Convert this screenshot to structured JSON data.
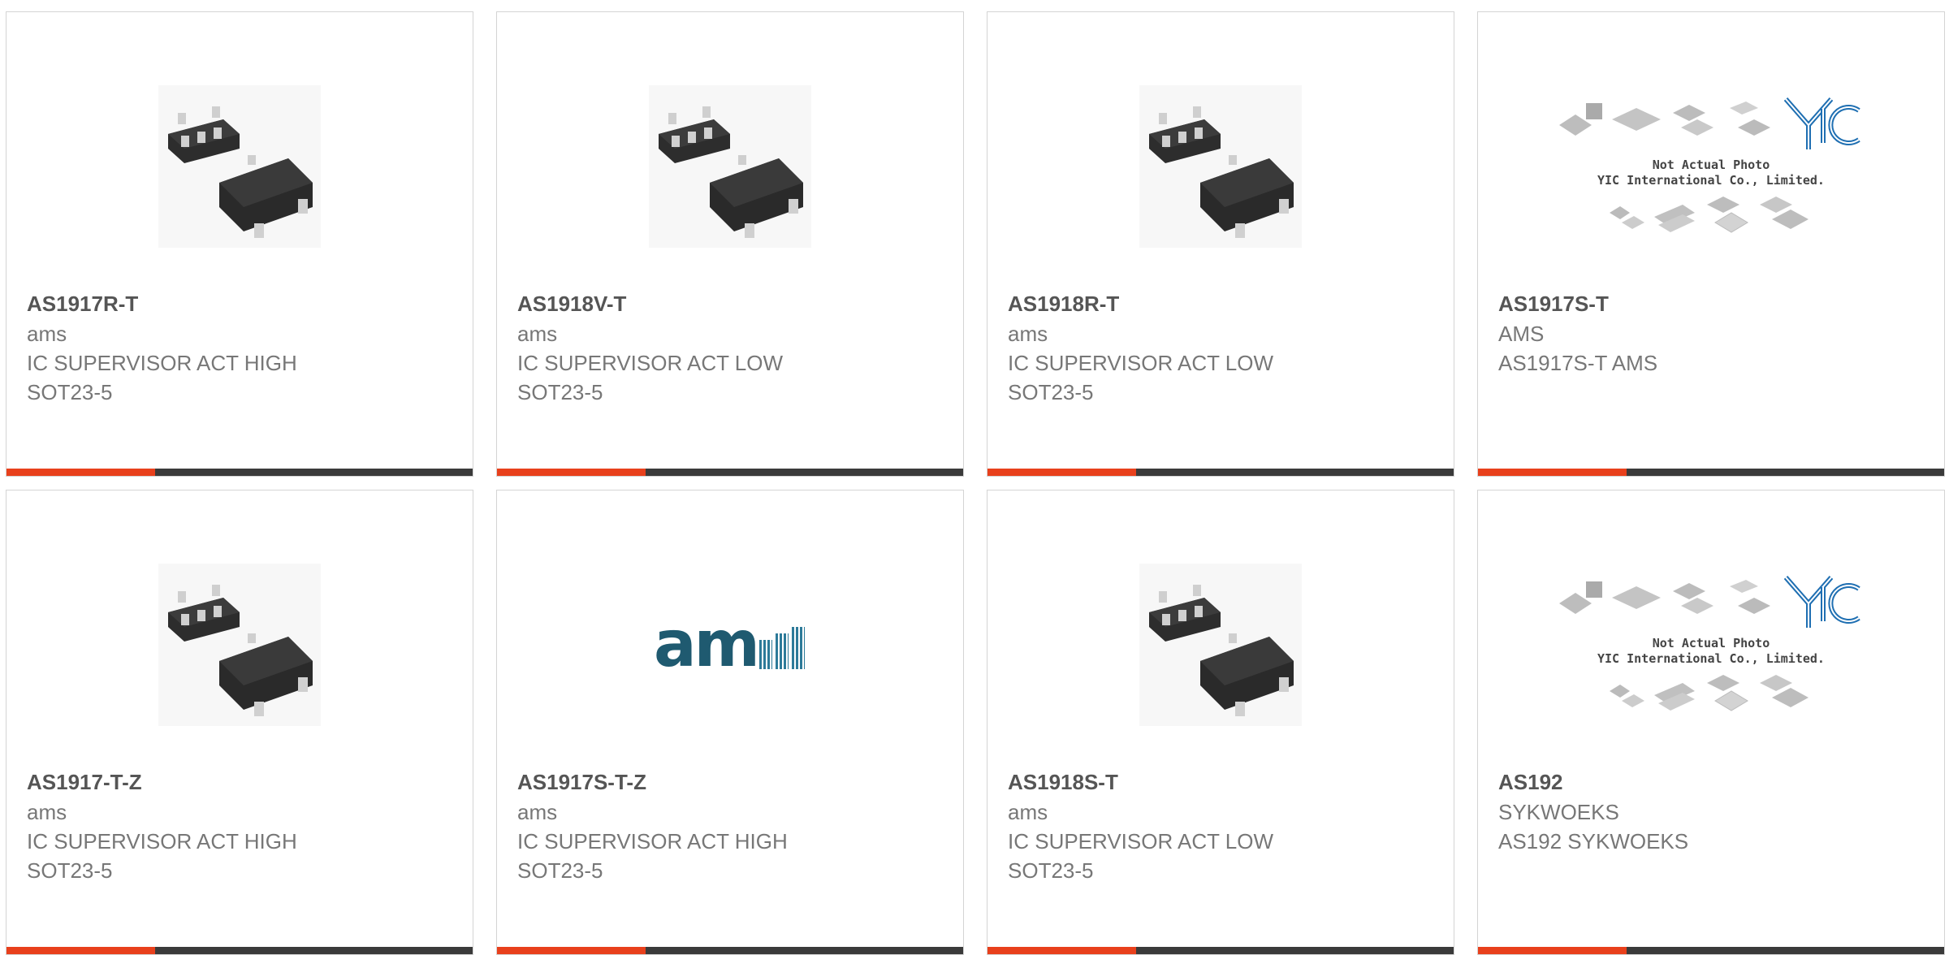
{
  "accent_color": "#e8401c",
  "bar_color": "#3a3a3a",
  "products": [
    {
      "part": "AS1917R-T",
      "lines": [
        "ams",
        "IC SUPERVISOR ACT HIGH",
        "SOT23-5"
      ],
      "image": "sot23-5-package"
    },
    {
      "part": "AS1918V-T",
      "lines": [
        "ams",
        "IC SUPERVISOR ACT LOW",
        "SOT23-5"
      ],
      "image": "sot23-5-package"
    },
    {
      "part": "AS1918R-T",
      "lines": [
        "ams",
        "IC SUPERVISOR ACT LOW",
        "SOT23-5"
      ],
      "image": "sot23-5-package"
    },
    {
      "part": "AS1917S-T",
      "lines": [
        "AMS",
        "AS1917S-T AMS"
      ],
      "image": "yic-placeholder"
    },
    {
      "part": "AS1917-T-Z",
      "lines": [
        "ams",
        "IC SUPERVISOR ACT HIGH",
        "SOT23-5"
      ],
      "image": "sot23-5-package"
    },
    {
      "part": "AS1917S-T-Z",
      "lines": [
        "ams",
        "IC SUPERVISOR ACT HIGH",
        "SOT23-5"
      ],
      "image": "ams-logo"
    },
    {
      "part": "AS1918S-T",
      "lines": [
        "ams",
        "IC SUPERVISOR ACT LOW",
        "SOT23-5"
      ],
      "image": "sot23-5-package"
    },
    {
      "part": "AS192",
      "lines": [
        "SYKWOEKS",
        "AS192 SYKWOEKS"
      ],
      "image": "yic-placeholder"
    }
  ],
  "placeholder": {
    "line1": "Not Actual Photo",
    "line2": "YIC International Co., Limited.",
    "logo": "YIC"
  },
  "ams_logo_text": "am"
}
